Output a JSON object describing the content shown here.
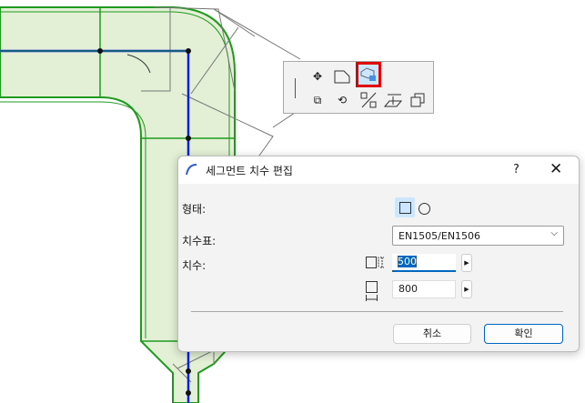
{
  "toolbar": {
    "icons": [
      "vertical-divider",
      "move-icon",
      "corner-icon",
      "edit-segment-dimensions-icon",
      "move-copy-icon",
      "rotate-icon",
      "split-icon",
      "elevate-icon",
      "multiply-icon"
    ],
    "selected": "edit-segment-dimensions-icon"
  },
  "dialog": {
    "title": "세그먼트 치수 편집",
    "help": "?",
    "shape_label": "형태:",
    "shape_selected": "rectangular",
    "table_label": "치수표:",
    "table_value": "EN1505/EN1506",
    "size_label": "치수:",
    "height_value": "500",
    "width_value": "800",
    "cancel_label": "취소",
    "ok_label": "확인"
  },
  "colors": {
    "duct_fill": "#e3f0d5",
    "duct_line": "#1f9a1f",
    "centerline": "#0a1ee0",
    "accent": "#0067c0",
    "highlight": "#e00000"
  }
}
